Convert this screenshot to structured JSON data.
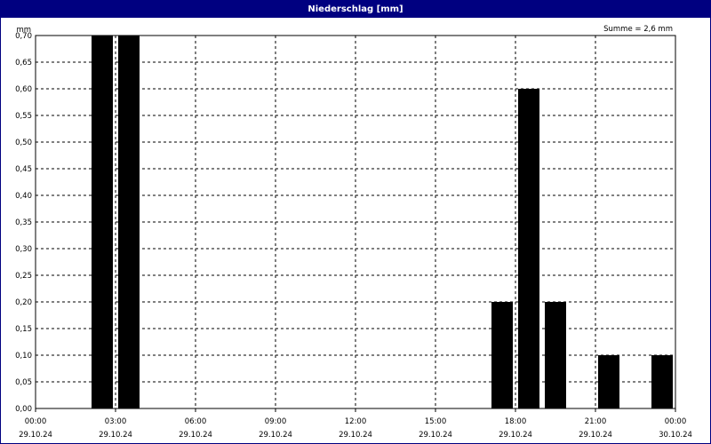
{
  "window": {
    "title": "Niederschlag [mm]"
  },
  "chart_data": {
    "type": "bar",
    "title": "Niederschlag [mm]",
    "ylabel": "mm",
    "annotation": "Summe = 2,6 mm",
    "ylim": [
      0,
      0.7
    ],
    "xlim_hours": [
      0,
      24
    ],
    "yticks": [
      "0,00",
      "0,05",
      "0,10",
      "0,15",
      "0,20",
      "0,25",
      "0,30",
      "0,35",
      "0,40",
      "0,45",
      "0,50",
      "0,55",
      "0,60",
      "0,65",
      "0,70"
    ],
    "xticks": [
      {
        "time": "00:00",
        "date": "29.10.24",
        "hour": 0
      },
      {
        "time": "03:00",
        "date": "29.10.24",
        "hour": 3
      },
      {
        "time": "06:00",
        "date": "29.10.24",
        "hour": 6
      },
      {
        "time": "09:00",
        "date": "29.10.24",
        "hour": 9
      },
      {
        "time": "12:00",
        "date": "29.10.24",
        "hour": 12
      },
      {
        "time": "15:00",
        "date": "29.10.24",
        "hour": 15
      },
      {
        "time": "18:00",
        "date": "29.10.24",
        "hour": 18
      },
      {
        "time": "21:00",
        "date": "29.10.24",
        "hour": 21
      },
      {
        "time": "00:00",
        "date": "30.10.24",
        "hour": 24
      }
    ],
    "bars": [
      {
        "hour": 3,
        "value": 0.7
      },
      {
        "hour": 4,
        "value": 0.7
      },
      {
        "hour": 18,
        "value": 0.2
      },
      {
        "hour": 19,
        "value": 0.6
      },
      {
        "hour": 20,
        "value": 0.2
      },
      {
        "hour": 22,
        "value": 0.1
      },
      {
        "hour": 24,
        "value": 0.1
      }
    ],
    "grid": true,
    "bar_color": "#000000"
  }
}
